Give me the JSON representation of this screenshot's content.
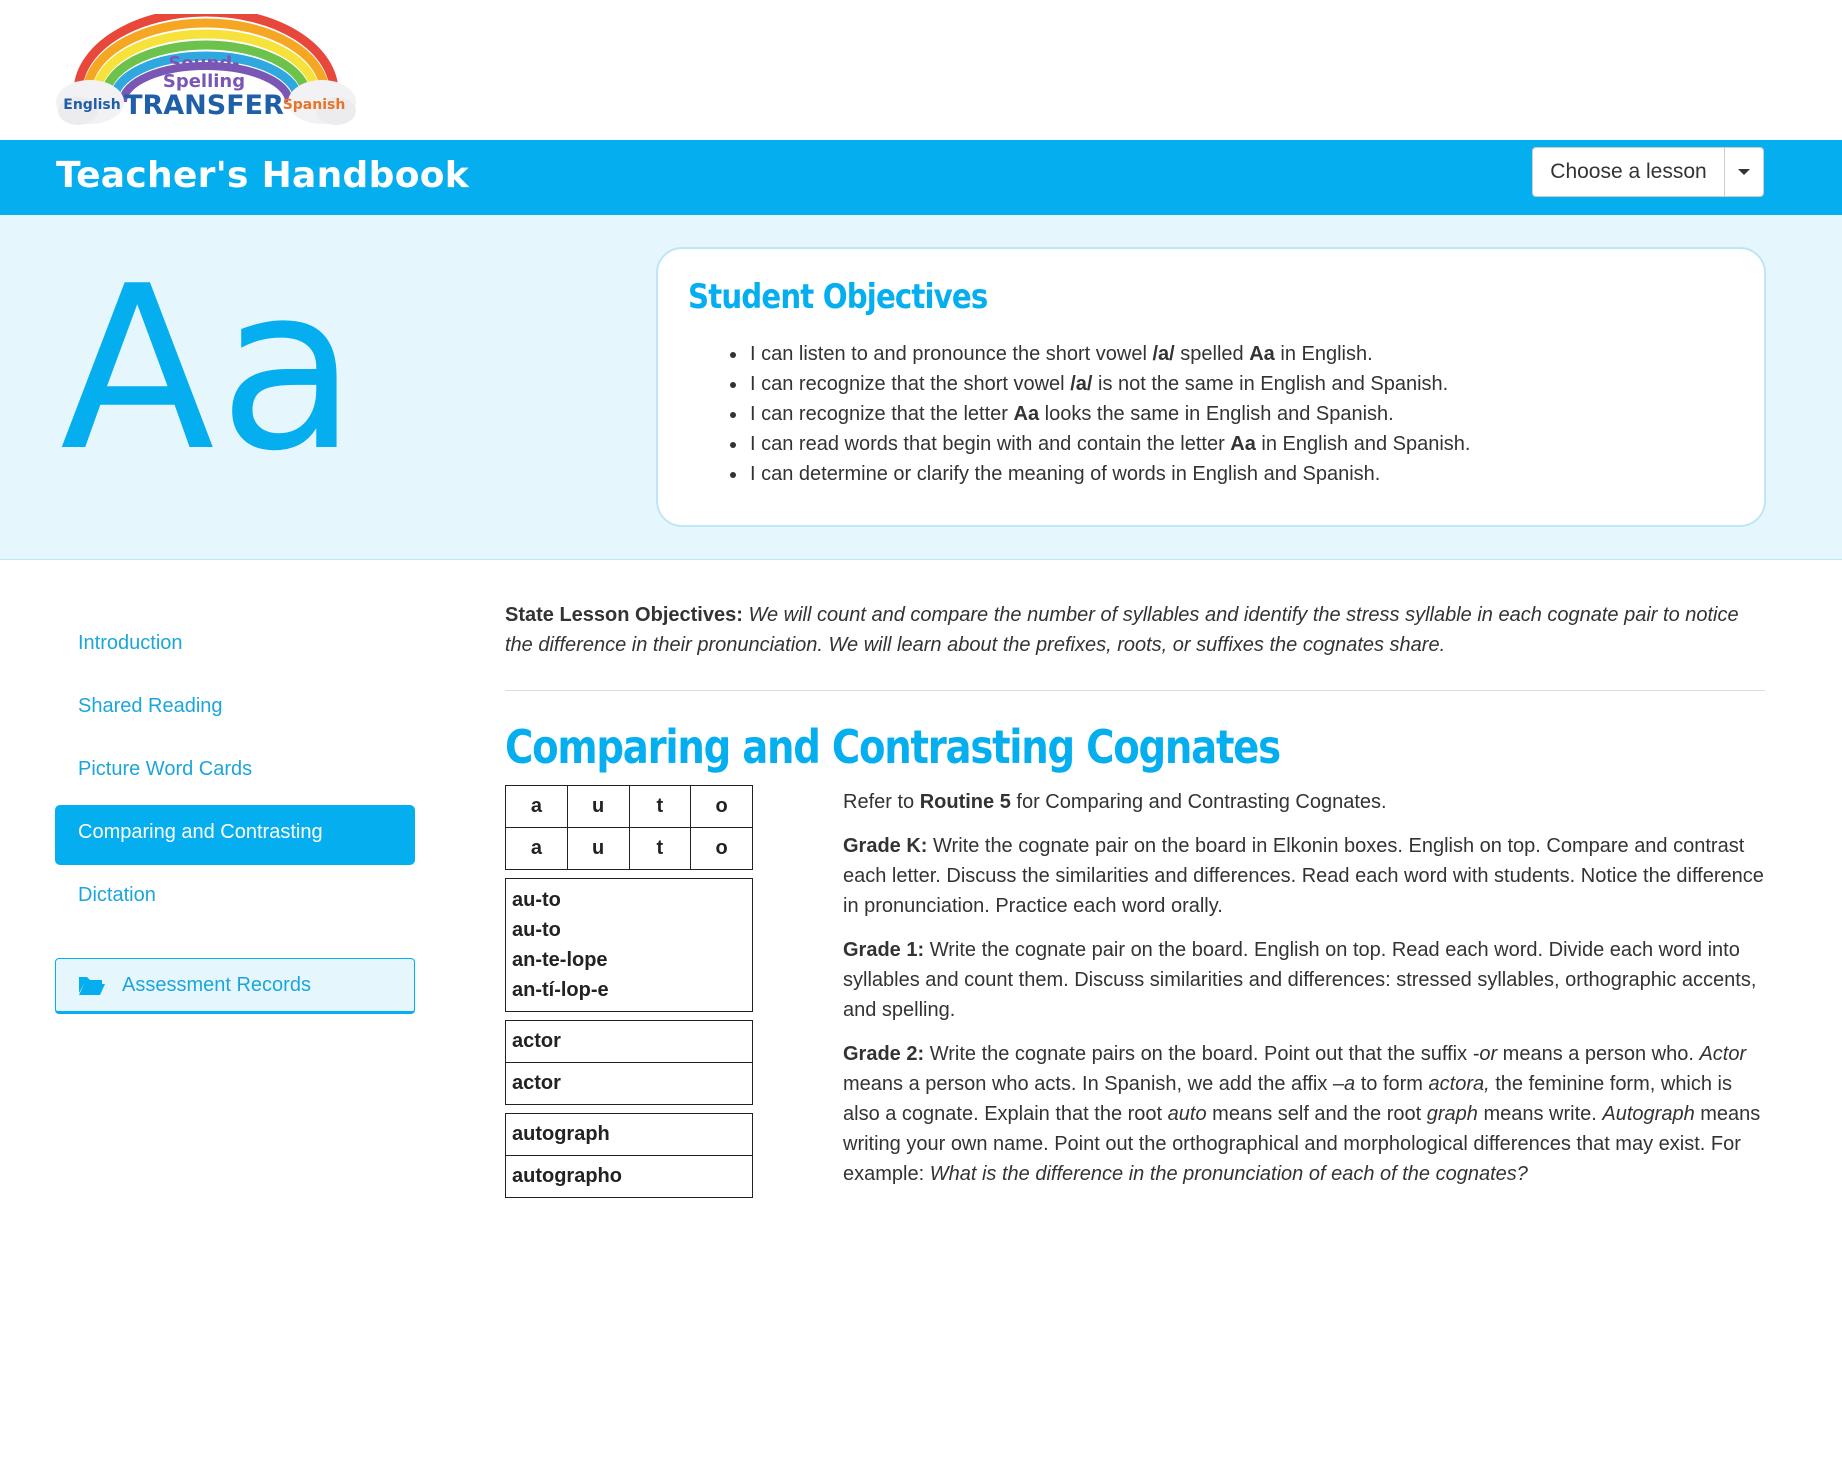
{
  "logo": {
    "line1": "Sound-",
    "line2": "Spelling",
    "word": "TRANSFER",
    "left_tag": "English",
    "right_tag": "Spanish"
  },
  "header": {
    "title": "Teacher's Handbook",
    "lesson_select_label": "Choose a lesson"
  },
  "hero": {
    "letter": "Aa",
    "objectives_title": "Student Objectives",
    "objectives": [
      {
        "pre": "I can listen to and pronounce the short vowel ",
        "strong": "/a/",
        "post": " spelled ",
        "strong2": "Aa",
        "post2": " in English."
      },
      {
        "pre": "I can recognize that the short vowel ",
        "strong": "/a/",
        "post": " is not the same in English and Spanish.",
        "strong2": "",
        "post2": ""
      },
      {
        "pre": "I can recognize that the letter ",
        "strong": "Aa",
        "post": " looks the same in English and Spanish.",
        "strong2": "",
        "post2": ""
      },
      {
        "pre": "I can read words that begin with and contain the letter ",
        "strong": "Aa",
        "post": " in English and Spanish.",
        "strong2": "",
        "post2": ""
      },
      {
        "pre": "I can determine or clarify the meaning of words in English and Spanish.",
        "strong": "",
        "post": "",
        "strong2": "",
        "post2": ""
      }
    ]
  },
  "sidebar": {
    "items": [
      {
        "label": "Introduction",
        "active": false
      },
      {
        "label": "Shared Reading",
        "active": false
      },
      {
        "label": "Picture Word Cards",
        "active": false
      },
      {
        "label": "Comparing and Contrasting",
        "active": true
      },
      {
        "label": "Dictation",
        "active": false
      }
    ],
    "assessment_label": "Assessment Records"
  },
  "main": {
    "state_label": "State Lesson Objectives:",
    "state_text": "We will count and compare the number of syllables and identify the stress syllable in each cognate pair to notice the difference in their pronunciation. We will learn about the prefixes, roots, or suffixes the cognates share.",
    "section_title": "Comparing and Contrasting Cognates",
    "elkonin_rows": [
      [
        "a",
        "u",
        "t",
        "o"
      ],
      [
        "a",
        "u",
        "t",
        "o"
      ]
    ],
    "syllable_lines": [
      "au-to",
      "au-to",
      "an-te-lope",
      "an-tí-lop-e"
    ],
    "pair_actor": [
      "actor",
      "actor"
    ],
    "pair_autograph": [
      "autograph",
      "autographo"
    ],
    "routine": {
      "pre": "Refer to ",
      "strong": "Routine 5",
      "post": " for Comparing and Contrasting Cognates."
    },
    "grade_k": {
      "label": "Grade K:",
      "text": " Write the cognate pair on the board in Elkonin boxes. English on top. Compare and contrast each letter. Discuss the similarities and differences. Read each word with students. Notice the difference in pronunciation. Practice each word orally."
    },
    "grade_1": {
      "label": "Grade 1:",
      "text": " Write the cognate pair on the board. English on top. Read each word. Divide each word into syllables and count them. Discuss similarities and differences: stressed syllables, orthographic accents, and spelling."
    },
    "grade_2": {
      "label": "Grade 2:",
      "t1": " Write the cognate pairs on the board. Point out that the suffix ",
      "i1": "-or",
      "t2": " means a person who. ",
      "i2": "Actor",
      "t3": " means a person who acts. In Spanish, we add the affix ",
      "i3": "–a",
      "t4": " to form ",
      "i4": "actora,",
      "t5": " the feminine form, which is also a cognate. Explain that the root ",
      "i5": "auto",
      "t6": " means self and the root ",
      "i6": "graph",
      "t7": " means write. ",
      "i7": "Autograph",
      "t8": " means writing your own name. Point out the orthographical and morphological differences that may exist. For example: ",
      "i8": "What is the difference in the pronunciation of each of the cognates?"
    }
  },
  "colors": {
    "accent": "#05aeef",
    "hero_bg": "#e6f6fd",
    "text": "#333333",
    "link": "#1ba6db"
  },
  "icons": {
    "folder": "folder-open-icon",
    "caret": "caret-down-icon"
  }
}
